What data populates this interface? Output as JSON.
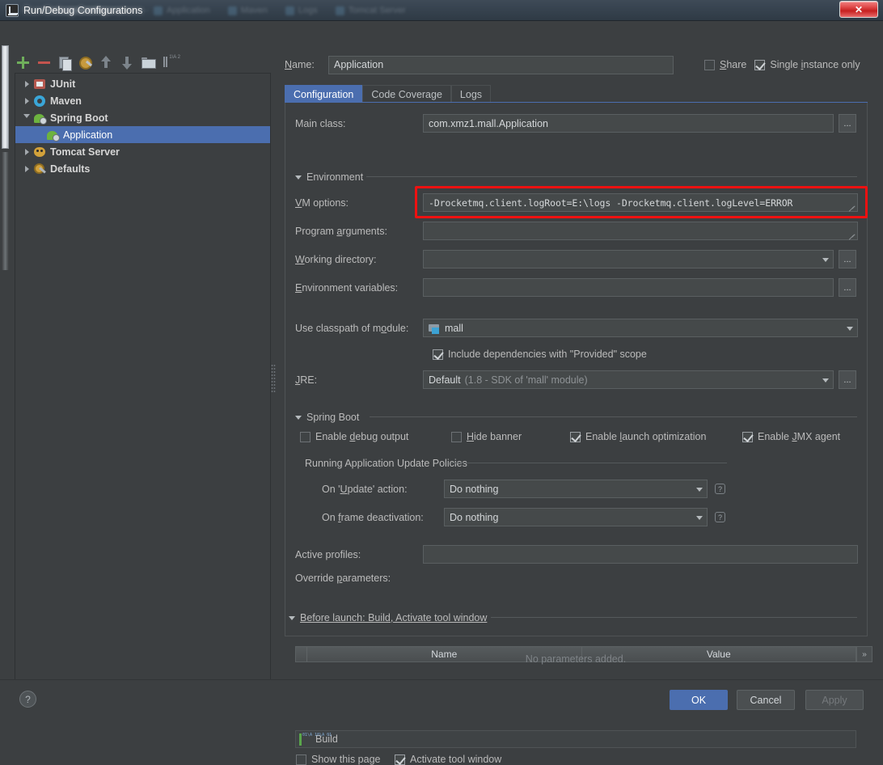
{
  "window": {
    "title": "Run/Debug Configurations",
    "close_label": "✕",
    "ghost_tabs": [
      "Application",
      "Maven",
      "Logs",
      "Tomcat Server"
    ]
  },
  "toolbar": {
    "items": [
      {
        "name": "add-configuration-button",
        "icon": "plus-icon"
      },
      {
        "name": "remove-configuration-button",
        "icon": "minus-icon"
      },
      {
        "name": "copy-configuration-button",
        "icon": "copy-icon"
      },
      {
        "name": "edit-templates-button",
        "icon": "gear-icon"
      },
      {
        "name": "move-up-button",
        "icon": "arrow-up-icon"
      },
      {
        "name": "move-down-button",
        "icon": "arrow-down-icon"
      },
      {
        "name": "create-folder-button",
        "icon": "folder-icon"
      },
      {
        "name": "sort-configurations-button",
        "icon": "sort-icon"
      }
    ]
  },
  "sidebar": {
    "items": [
      {
        "label": "JUnit",
        "icon": "junit-icon",
        "expanded": false,
        "selected": false,
        "indent": 0
      },
      {
        "label": "Maven",
        "icon": "maven-icon",
        "expanded": false,
        "selected": false,
        "indent": 0
      },
      {
        "label": "Spring Boot",
        "icon": "spring-icon",
        "expanded": true,
        "selected": false,
        "indent": 0
      },
      {
        "label": "Application",
        "icon": "spring-icon",
        "expanded": null,
        "selected": true,
        "indent": 1
      },
      {
        "label": "Tomcat Server",
        "icon": "tomcat-icon",
        "expanded": false,
        "selected": false,
        "indent": 0
      },
      {
        "label": "Defaults",
        "icon": "defaults-icon",
        "expanded": false,
        "selected": false,
        "indent": 0
      }
    ]
  },
  "header": {
    "name_label": "Name:",
    "name_value": "Application",
    "share_label": "Share",
    "share_checked": false,
    "single_instance_label": "Single instance only",
    "single_instance_checked": true
  },
  "tabs": [
    {
      "label": "Configuration",
      "active": true
    },
    {
      "label": "Code Coverage",
      "active": false
    },
    {
      "label": "Logs",
      "active": false
    }
  ],
  "form": {
    "main_class_label": "Main class:",
    "main_class_value": "com.xmz1.mall.Application",
    "environment_group": "Environment",
    "vm_options_label": "VM options:",
    "vm_options_value": "-Drocketmq.client.logRoot=E:\\logs -Drocketmq.client.logLevel=ERROR",
    "program_arguments_label": "Program arguments:",
    "program_arguments_value": "",
    "working_directory_label": "Working directory:",
    "working_directory_value": "",
    "environment_variables_label": "Environment variables:",
    "environment_variables_value": "",
    "classpath_label": "Use classpath of module:",
    "classpath_value": "mall",
    "include_provided_label": "Include dependencies with \"Provided\" scope",
    "include_provided_checked": true,
    "jre_label": "JRE:",
    "jre_value": "Default",
    "jre_hint": "(1.8 - SDK of 'mall' module)",
    "browse_label": "..."
  },
  "spring_boot": {
    "group_label": "Spring Boot",
    "checkboxes": [
      {
        "label": "Enable debug output",
        "checked": false
      },
      {
        "label": "Hide banner",
        "checked": false
      },
      {
        "label": "Enable launch optimization",
        "checked": true
      },
      {
        "label": "Enable JMX agent",
        "checked": true
      }
    ],
    "update_policies_label": "Running Application Update Policies",
    "on_update_label": "On 'Update' action:",
    "on_update_value": "Do nothing",
    "on_frame_label": "On frame deactivation:",
    "on_frame_value": "Do nothing",
    "help_glyph": "?",
    "active_profiles_label": "Active profiles:",
    "active_profiles_value": "",
    "override_params_label": "Override parameters:",
    "table_columns": [
      "Name",
      "Value"
    ],
    "table_empty_text": "No parameters added.",
    "table_more_glyph": "»"
  },
  "before_launch": {
    "group_label": "Before launch: Build, Activate tool window",
    "tool_buttons": [
      {
        "name": "add-task-button",
        "icon": "plus-icon"
      },
      {
        "name": "remove-task-button",
        "icon": "minus-icon"
      },
      {
        "name": "edit-task-button",
        "icon": "pencil-icon"
      },
      {
        "name": "move-task-up-button",
        "icon": "arrow-up-icon"
      },
      {
        "name": "move-task-down-button",
        "icon": "arrow-down-icon"
      }
    ],
    "tasks": [
      {
        "label": "Build",
        "icon": "build-icon"
      }
    ],
    "show_page_label": "Show this page",
    "show_page_checked": false,
    "activate_window_label": "Activate tool window",
    "activate_window_checked": true
  },
  "footer": {
    "help_glyph": "?",
    "ok_label": "OK",
    "cancel_label": "Cancel",
    "apply_label": "Apply"
  },
  "colors": {
    "accent": "#4b6eaf",
    "highlight_box": "#ee1111",
    "background": "#3c3f41"
  }
}
